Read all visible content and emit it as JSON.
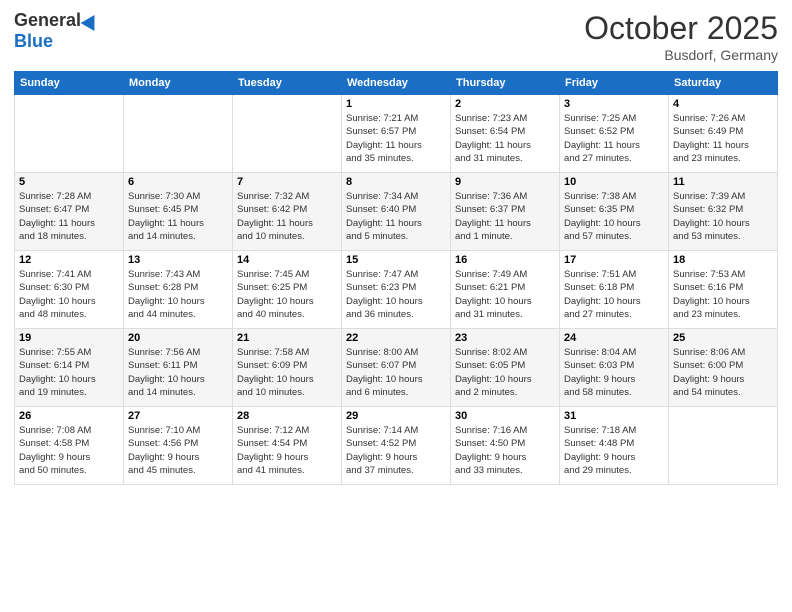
{
  "header": {
    "logo_general": "General",
    "logo_blue": "Blue",
    "month": "October 2025",
    "location": "Busdorf, Germany"
  },
  "days_of_week": [
    "Sunday",
    "Monday",
    "Tuesday",
    "Wednesday",
    "Thursday",
    "Friday",
    "Saturday"
  ],
  "weeks": [
    [
      null,
      null,
      null,
      {
        "day": 1,
        "sunrise": "7:21 AM",
        "sunset": "6:57 PM",
        "daylight": "11 hours and 35 minutes."
      },
      {
        "day": 2,
        "sunrise": "7:23 AM",
        "sunset": "6:54 PM",
        "daylight": "11 hours and 31 minutes."
      },
      {
        "day": 3,
        "sunrise": "7:25 AM",
        "sunset": "6:52 PM",
        "daylight": "11 hours and 27 minutes."
      },
      {
        "day": 4,
        "sunrise": "7:26 AM",
        "sunset": "6:49 PM",
        "daylight": "11 hours and 23 minutes."
      }
    ],
    [
      {
        "day": 5,
        "sunrise": "7:28 AM",
        "sunset": "6:47 PM",
        "daylight": "11 hours and 18 minutes."
      },
      {
        "day": 6,
        "sunrise": "7:30 AM",
        "sunset": "6:45 PM",
        "daylight": "11 hours and 14 minutes."
      },
      {
        "day": 7,
        "sunrise": "7:32 AM",
        "sunset": "6:42 PM",
        "daylight": "11 hours and 10 minutes."
      },
      {
        "day": 8,
        "sunrise": "7:34 AM",
        "sunset": "6:40 PM",
        "daylight": "11 hours and 5 minutes."
      },
      {
        "day": 9,
        "sunrise": "7:36 AM",
        "sunset": "6:37 PM",
        "daylight": "11 hours and 1 minute."
      },
      {
        "day": 10,
        "sunrise": "7:38 AM",
        "sunset": "6:35 PM",
        "daylight": "10 hours and 57 minutes."
      },
      {
        "day": 11,
        "sunrise": "7:39 AM",
        "sunset": "6:32 PM",
        "daylight": "10 hours and 53 minutes."
      }
    ],
    [
      {
        "day": 12,
        "sunrise": "7:41 AM",
        "sunset": "6:30 PM",
        "daylight": "10 hours and 48 minutes."
      },
      {
        "day": 13,
        "sunrise": "7:43 AM",
        "sunset": "6:28 PM",
        "daylight": "10 hours and 44 minutes."
      },
      {
        "day": 14,
        "sunrise": "7:45 AM",
        "sunset": "6:25 PM",
        "daylight": "10 hours and 40 minutes."
      },
      {
        "day": 15,
        "sunrise": "7:47 AM",
        "sunset": "6:23 PM",
        "daylight": "10 hours and 36 minutes."
      },
      {
        "day": 16,
        "sunrise": "7:49 AM",
        "sunset": "6:21 PM",
        "daylight": "10 hours and 31 minutes."
      },
      {
        "day": 17,
        "sunrise": "7:51 AM",
        "sunset": "6:18 PM",
        "daylight": "10 hours and 27 minutes."
      },
      {
        "day": 18,
        "sunrise": "7:53 AM",
        "sunset": "6:16 PM",
        "daylight": "10 hours and 23 minutes."
      }
    ],
    [
      {
        "day": 19,
        "sunrise": "7:55 AM",
        "sunset": "6:14 PM",
        "daylight": "10 hours and 19 minutes."
      },
      {
        "day": 20,
        "sunrise": "7:56 AM",
        "sunset": "6:11 PM",
        "daylight": "10 hours and 14 minutes."
      },
      {
        "day": 21,
        "sunrise": "7:58 AM",
        "sunset": "6:09 PM",
        "daylight": "10 hours and 10 minutes."
      },
      {
        "day": 22,
        "sunrise": "8:00 AM",
        "sunset": "6:07 PM",
        "daylight": "10 hours and 6 minutes."
      },
      {
        "day": 23,
        "sunrise": "8:02 AM",
        "sunset": "6:05 PM",
        "daylight": "10 hours and 2 minutes."
      },
      {
        "day": 24,
        "sunrise": "8:04 AM",
        "sunset": "6:03 PM",
        "daylight": "9 hours and 58 minutes."
      },
      {
        "day": 25,
        "sunrise": "8:06 AM",
        "sunset": "6:00 PM",
        "daylight": "9 hours and 54 minutes."
      }
    ],
    [
      {
        "day": 26,
        "sunrise": "7:08 AM",
        "sunset": "4:58 PM",
        "daylight": "9 hours and 50 minutes."
      },
      {
        "day": 27,
        "sunrise": "7:10 AM",
        "sunset": "4:56 PM",
        "daylight": "9 hours and 45 minutes."
      },
      {
        "day": 28,
        "sunrise": "7:12 AM",
        "sunset": "4:54 PM",
        "daylight": "9 hours and 41 minutes."
      },
      {
        "day": 29,
        "sunrise": "7:14 AM",
        "sunset": "4:52 PM",
        "daylight": "9 hours and 37 minutes."
      },
      {
        "day": 30,
        "sunrise": "7:16 AM",
        "sunset": "4:50 PM",
        "daylight": "9 hours and 33 minutes."
      },
      {
        "day": 31,
        "sunrise": "7:18 AM",
        "sunset": "4:48 PM",
        "daylight": "9 hours and 29 minutes."
      },
      null
    ]
  ],
  "labels": {
    "sunrise": "Sunrise:",
    "sunset": "Sunset:",
    "daylight": "Daylight:"
  }
}
